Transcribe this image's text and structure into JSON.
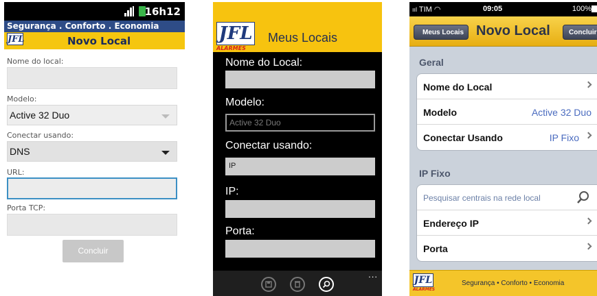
{
  "android": {
    "status_time": "16h12",
    "slogan": "Segurança . Conforto . Economia",
    "logo_text": "JFL",
    "title": "Novo Local",
    "fields": {
      "nome_label": "Nome do local:",
      "modelo_label": "Modelo:",
      "modelo_value": "Active 32 Duo",
      "conectar_label": "Conectar usando:",
      "conectar_value": "DNS",
      "url_label": "URL:",
      "porta_label": "Porta TCP:"
    },
    "button_label": "Concluir"
  },
  "windows_phone": {
    "logo_text": "JFL",
    "logo_sub": "ALARMES",
    "title": "Meus Locais",
    "nome_label": "Nome do Local:",
    "modelo_label": "Modelo:",
    "modelo_placeholder": "Active 32 Duo",
    "conectar_label": "Conectar usando:",
    "conectar_value": "IP",
    "ip_label": "IP:",
    "porta_label": "Porta:",
    "appbar": [
      "save-icon",
      "delete-icon",
      "search-icon"
    ],
    "more": "..."
  },
  "ios": {
    "carrier": "TIM",
    "time": "09:05",
    "battery": "100%",
    "back_label": "Meus Locais",
    "title": "Novo Local",
    "done_label": "Concluir",
    "section_geral": "Geral",
    "rows_geral": [
      {
        "key": "Nome do Local",
        "value": ""
      },
      {
        "key": "Modelo",
        "value": "Active 32 Duo"
      },
      {
        "key": "Conectar Usando",
        "value": "IP Fixo"
      }
    ],
    "section_ip": "IP Fixo",
    "search_placeholder": "Pesquisar centrais na rede local",
    "rows_ip": [
      {
        "key": "Endereço IP"
      },
      {
        "key": "Porta"
      }
    ],
    "logo_text": "JFL",
    "logo_sub": "ALARMES",
    "footer_slogan": "Segurança • Conforto • Economia"
  },
  "colors": {
    "jfl_yellow": "#f5c60f",
    "jfl_blue": "#2e4c87",
    "focus_blue": "#3b8fc4",
    "ios_value_blue": "#4a6bbf"
  }
}
